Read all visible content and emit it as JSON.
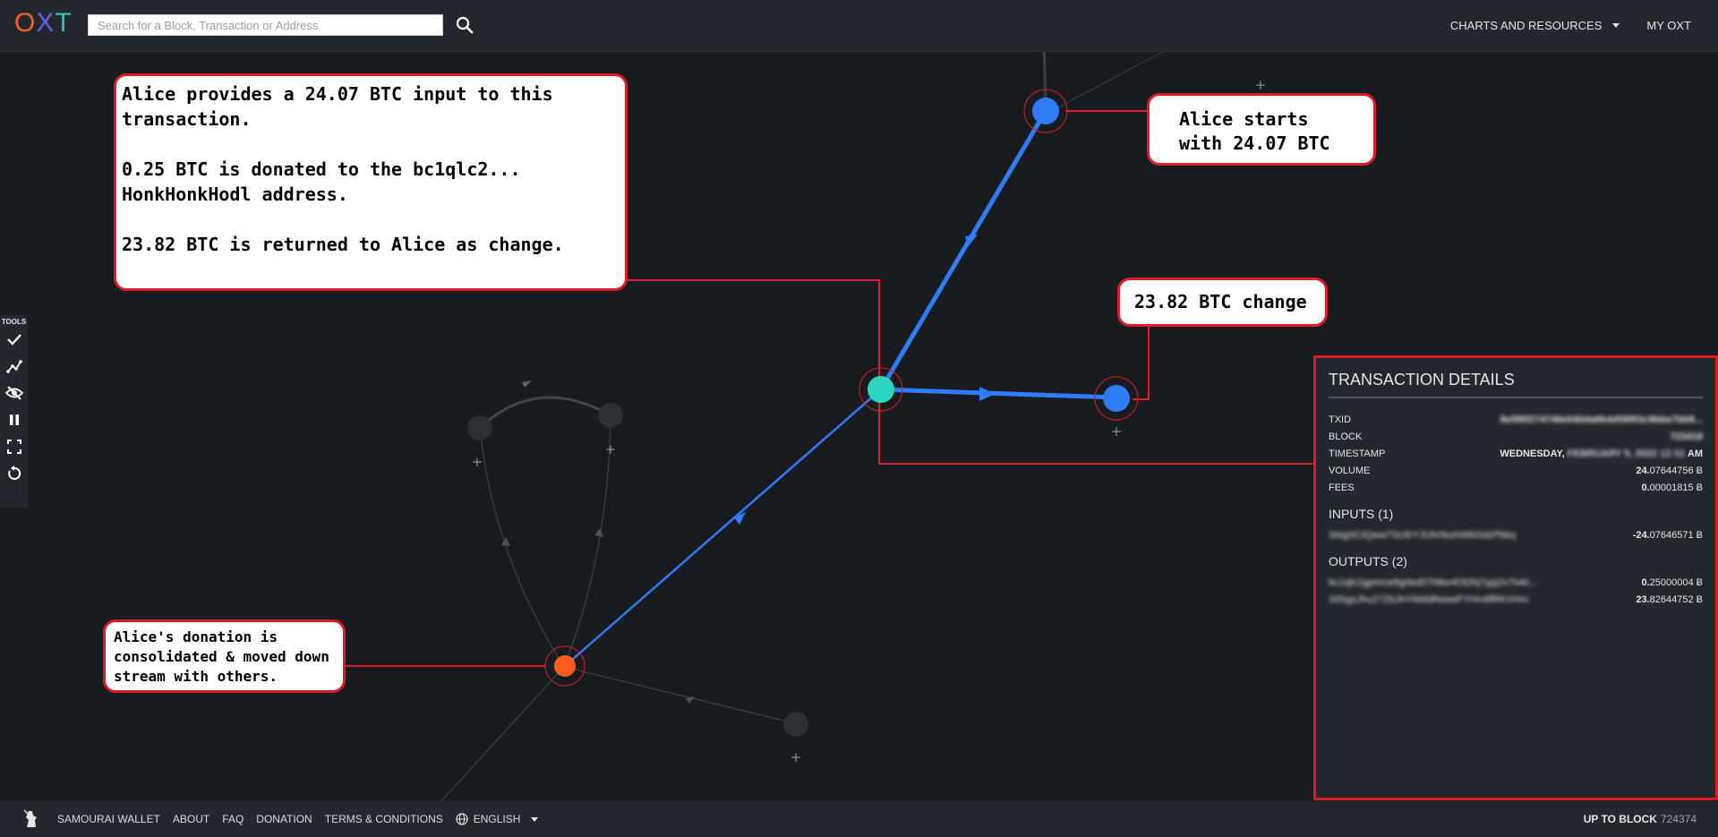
{
  "header": {
    "logo": "OXT",
    "search_placeholder": "Search for a Block, Transaction or Address",
    "nav": [
      {
        "label": "CHARTS AND RESOURCES"
      },
      {
        "label": "MY OXT"
      }
    ]
  },
  "tools": {
    "label": "TOOLS"
  },
  "graph": {
    "plus_label": "+"
  },
  "callouts": {
    "main": "Alice provides a 24.07 BTC input to this\ntransaction.\n\n0.25 BTC is donated to the bc1qlc2...\nHonkHonkHodl address.\n\n23.82 BTC is returned to Alice as change.",
    "start": "Alice starts\nwith 24.07 BTC",
    "change": "23.82 BTC change",
    "donation": "Alice's donation is\nconsolidated & moved down\nstream with others."
  },
  "details": {
    "title": "TRANSACTION DETAILS",
    "rows": [
      {
        "key": "TXID",
        "value": "8e5f6f274746e040da6b4d58f03c9bbe7bb8..."
      },
      {
        "key": "BLOCK",
        "value": "723418"
      },
      {
        "key": "TIMESTAMP",
        "value_pre": "WEDNESDAY,",
        "value_blur": "FEBRUARY 9, 2022 12:31",
        "value_post": "AM"
      },
      {
        "key": "VOLUME",
        "value_int": "24.",
        "value_dec": "07644756 Ƀ"
      },
      {
        "key": "FEES",
        "value_int": "0.",
        "value_dec": "00001815 Ƀ"
      }
    ],
    "inputs_title": "INPUTS (1)",
    "inputs": [
      {
        "address": "3AigSCtQww7Sc9rYJUhr9szhWbGdzPbkq",
        "amount_int": "-24.",
        "amount_dec": "07646571 Ƀ"
      }
    ],
    "outputs_title": "OUTPUTS (2)",
    "outputs": [
      {
        "address": "bc1qlc2gpmcw9g0ed07t9ke4Ot2hj7ypj2v7tvkl...",
        "amount_int": "0.",
        "amount_dec": "25000004 Ƀ"
      },
      {
        "address": "33SgsJhu27ZbJHYkMdReewFYHn4lfRKVHm",
        "amount_int": "23.",
        "amount_dec": "82644752 Ƀ"
      }
    ]
  },
  "footer": {
    "links": [
      "SAMOURAI WALLET",
      "ABOUT",
      "FAQ",
      "DONATION",
      "TERMS & CONDITIONS"
    ],
    "language": "ENGLISH",
    "up_to_block_label": "UP TO BLOCK",
    "up_to_block_value": "724374"
  },
  "colors": {
    "accent_red": "#e01b24",
    "node_blue": "#2f7cf6",
    "node_teal": "#2dd4bf",
    "node_orange": "#ff5a1f",
    "node_gray": "#2b3035"
  }
}
